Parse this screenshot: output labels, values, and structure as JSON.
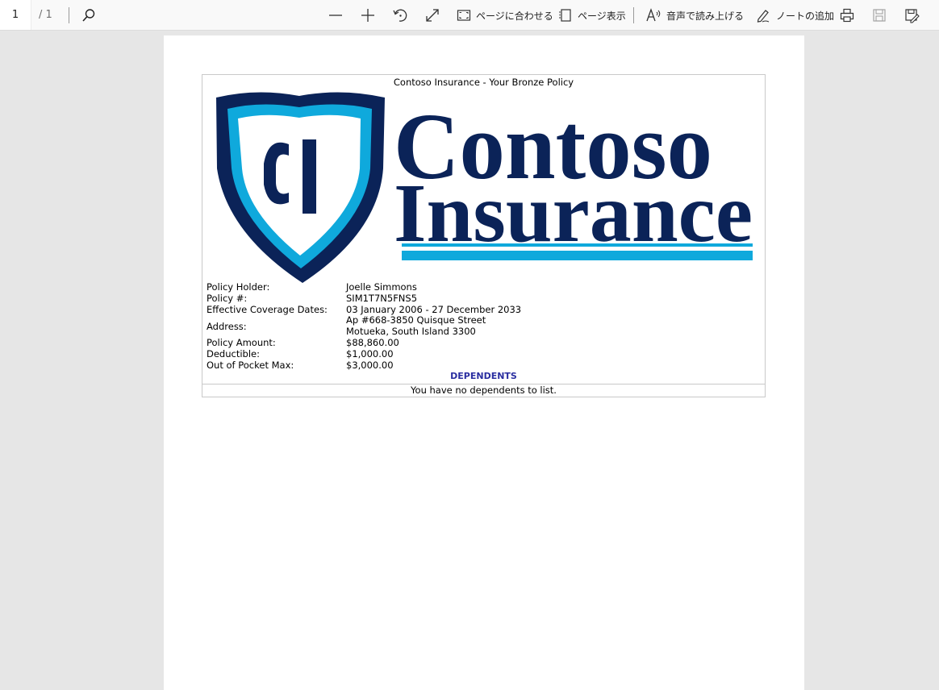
{
  "toolbar": {
    "current_page": "1",
    "page_count": "/ 1",
    "fit_page_label": "ページに合わせる",
    "page_view_label": "ページ表示",
    "read_aloud_label": "音声で読み上げる",
    "add_notes_label": "ノートの追加",
    "icons": [
      "search-icon",
      "zoom-out-icon",
      "zoom-in-icon",
      "rotate-icon",
      "fullscreen-icon",
      "fit-page-icon",
      "page-view-icon",
      "read-aloud-icon",
      "pen-icon",
      "print-icon",
      "save-icon",
      "save-as-icon"
    ]
  },
  "document": {
    "title": "Contoso Insurance - Your Bronze Policy",
    "logo": {
      "shield_text": "CI",
      "brand_line1": "Contoso",
      "brand_line2": "Insurance",
      "colors": {
        "navy": "#0b2358",
        "cyan": "#0fa9dc"
      }
    },
    "fields": [
      {
        "label": "Policy Holder:",
        "value": "Joelle Simmons"
      },
      {
        "label": "Policy #:",
        "value": "SIM1T7N5FNS5"
      },
      {
        "label": "Effective Coverage Dates:",
        "value": "03 January 2006 - 27 December 2033"
      }
    ],
    "address": {
      "label": "Address:",
      "line1": "Ap #668-3850 Quisque Street",
      "line2": "Motueka, South Island 3300"
    },
    "fields2": [
      {
        "label": "Policy Amount:",
        "value": "$88,860.00"
      },
      {
        "label": "Deductible:",
        "value": "$1,000.00"
      },
      {
        "label": "Out of Pocket Max:",
        "value": "$3,000.00"
      }
    ],
    "dependents_heading": "DEPENDENTS",
    "dependents_message": "You have no dependents to list."
  }
}
